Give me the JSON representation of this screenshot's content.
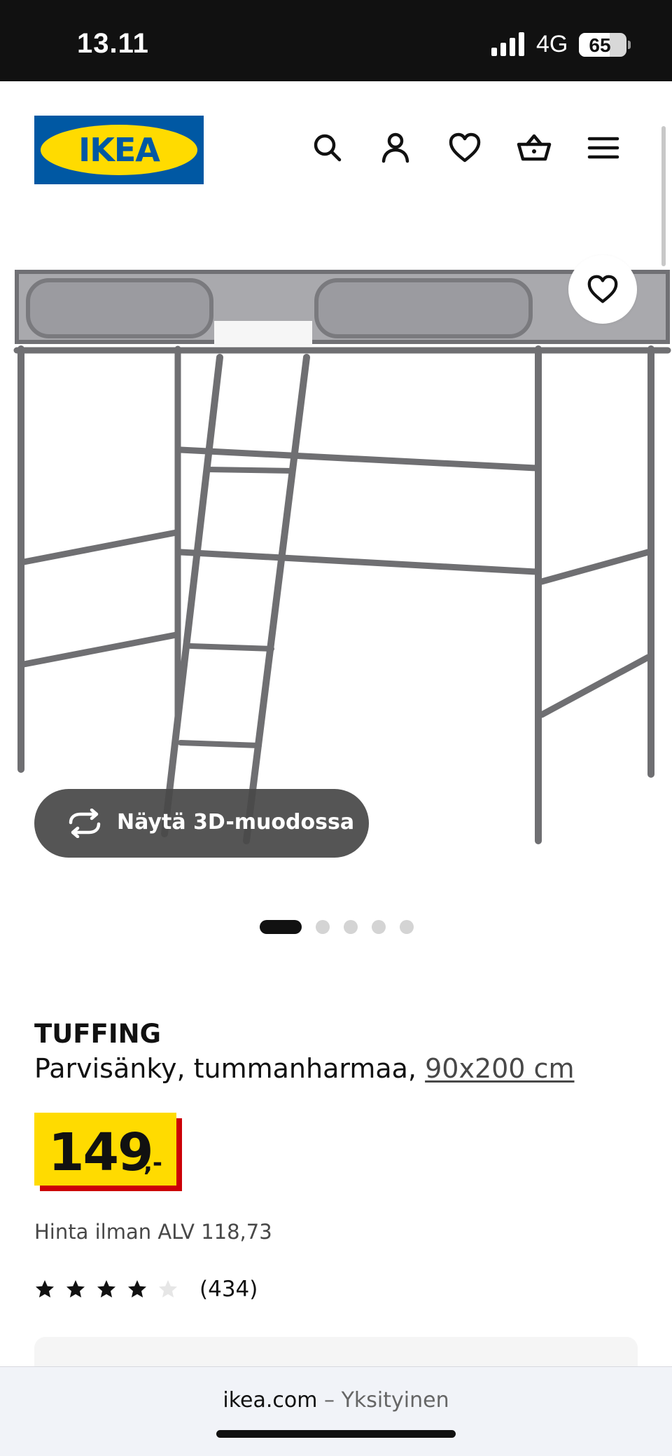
{
  "status_bar": {
    "time": "13.11",
    "network": "4G",
    "battery": "65"
  },
  "header": {
    "logo_text": "IKEA",
    "icons": [
      "search-icon",
      "account-icon",
      "favourites-icon",
      "basket-icon",
      "menu-icon"
    ]
  },
  "gallery": {
    "view_3d_label": "Näytä 3D-muodossa",
    "image_count": 5,
    "active_index": 0
  },
  "product": {
    "name": "TUFFING",
    "description": "Parvisänky, tummanharmaa,",
    "size_link": "90x200 cm",
    "price": "149",
    "price_suffix": ",-",
    "vat_note": "Hinta ilman ALV 118,73",
    "rating": 4,
    "rating_max": 5,
    "review_count": "(434)"
  },
  "browser": {
    "host": "ikea.com",
    "separator": "–",
    "mode": "Yksityinen"
  },
  "colors": {
    "brand_blue": "#0058a3",
    "brand_yellow": "#ffdb00",
    "price_red": "#cc0008"
  }
}
